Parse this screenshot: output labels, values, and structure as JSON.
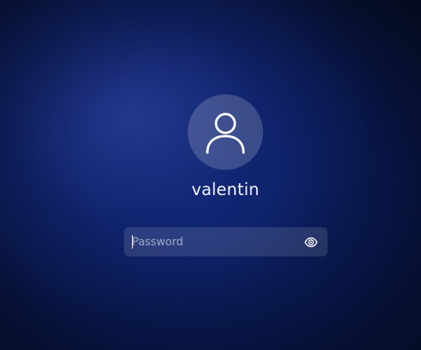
{
  "user": {
    "name": "valentin",
    "avatar_icon": "user-silhouette-icon"
  },
  "password": {
    "placeholder": "Password",
    "value": "",
    "reveal_icon": "eye-icon"
  },
  "colors": {
    "background_center": "#1a2f8a",
    "background_edge": "#050b22",
    "text": "#f2f4fa"
  }
}
